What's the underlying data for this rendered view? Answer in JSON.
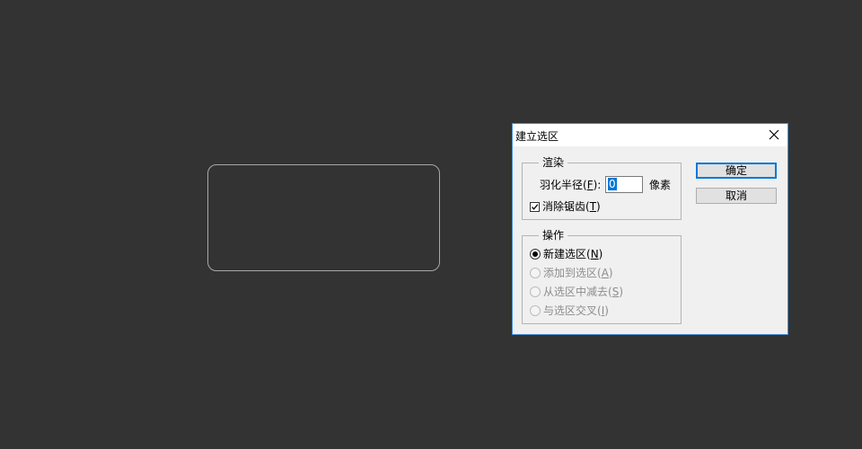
{
  "dialog": {
    "title": "建立选区",
    "render_group": {
      "legend": "渲染",
      "feather_label_prefix": "羽化半径(",
      "feather_label_key": "F",
      "feather_label_suffix": "):",
      "feather_value": "0",
      "unit": "像素",
      "antialias_prefix": "消除锯齿(",
      "antialias_key": "T",
      "antialias_suffix": ")",
      "antialias_checked": true
    },
    "ops_group": {
      "legend": "操作",
      "options": [
        {
          "prefix": "新建选区(",
          "key": "N",
          "suffix": ")",
          "selected": true,
          "enabled": true
        },
        {
          "prefix": "添加到选区(",
          "key": "A",
          "suffix": ")",
          "selected": false,
          "enabled": false
        },
        {
          "prefix": "从选区中减去(",
          "key": "S",
          "suffix": ")",
          "selected": false,
          "enabled": false
        },
        {
          "prefix": "与选区交叉(",
          "key": "I",
          "suffix": ")",
          "selected": false,
          "enabled": false
        }
      ]
    },
    "buttons": {
      "ok": "确定",
      "cancel": "取消"
    },
    "accent_color": "#0078d7"
  }
}
